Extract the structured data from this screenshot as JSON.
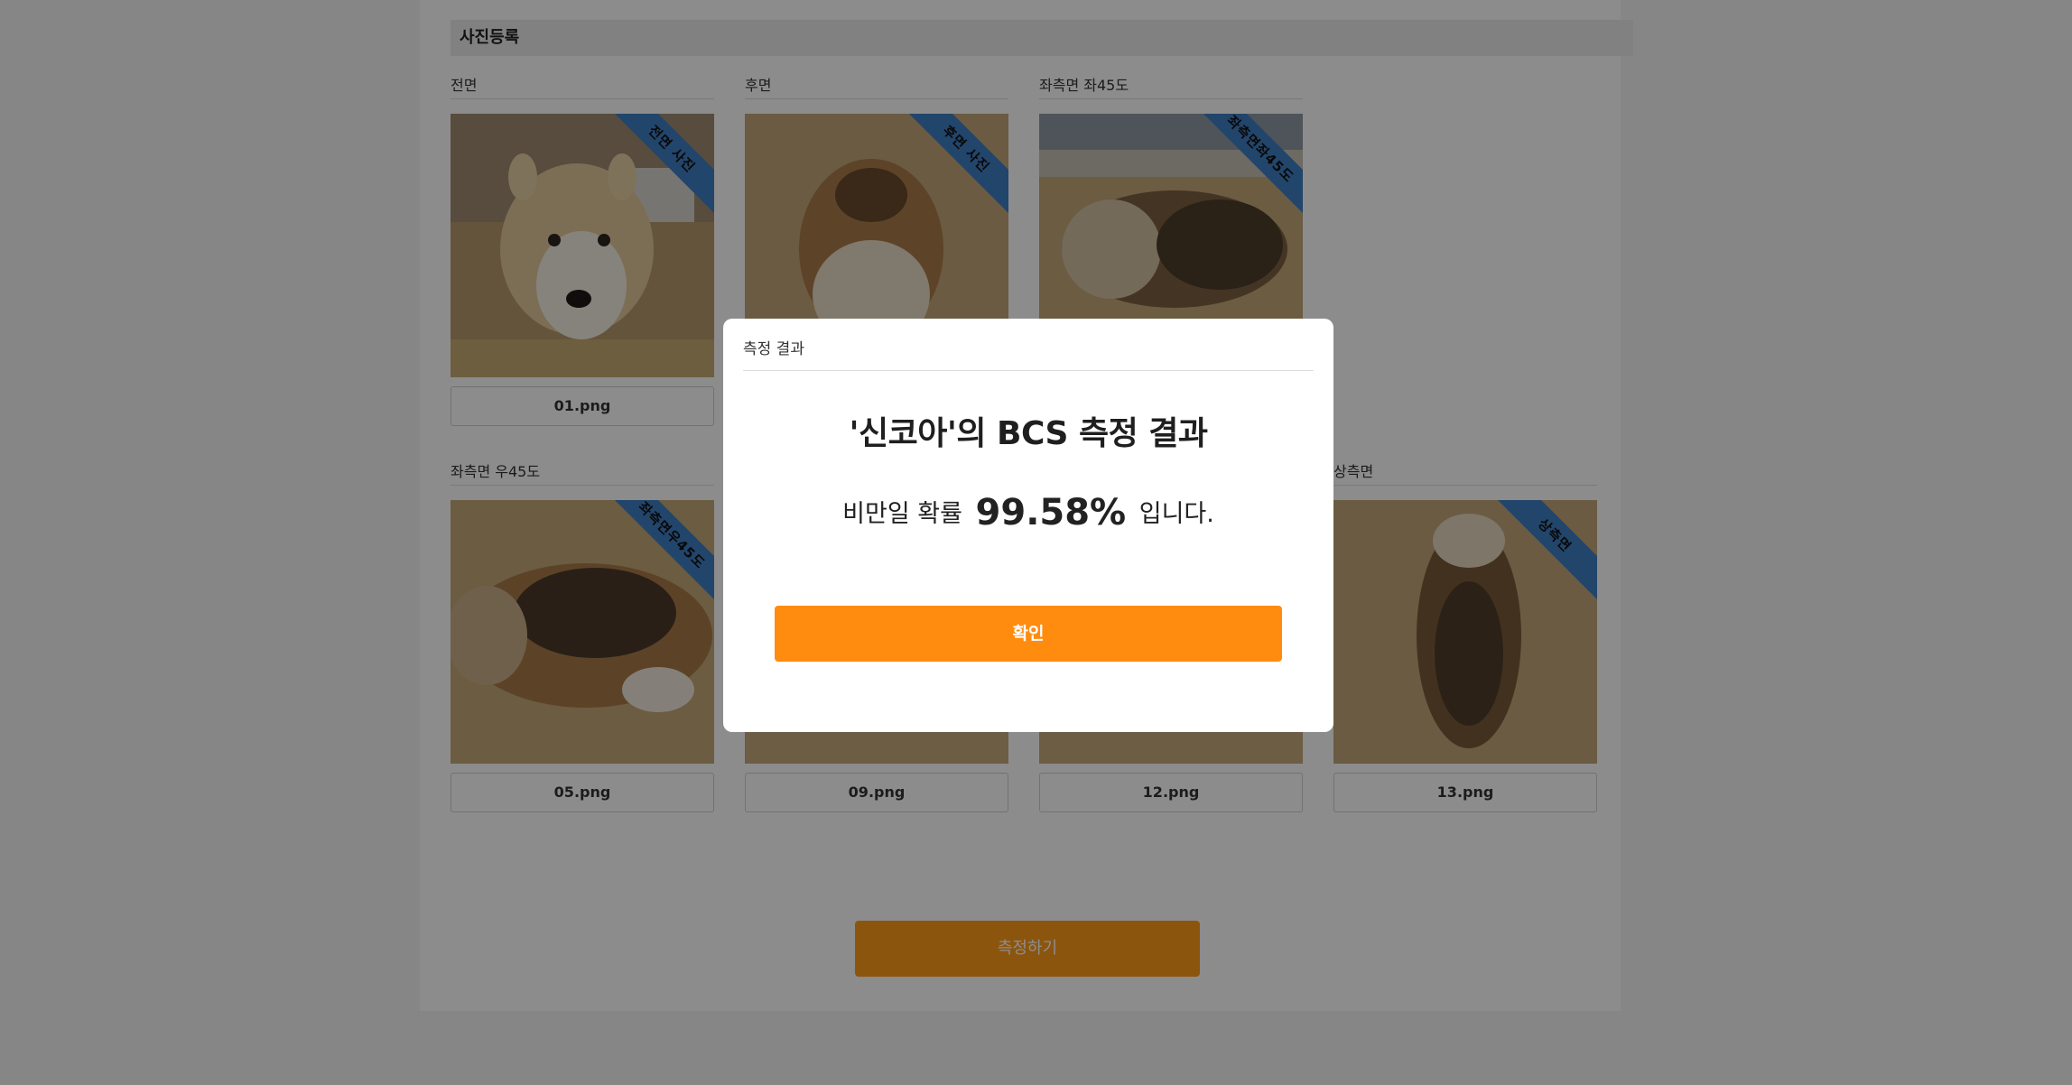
{
  "section": {
    "title": "사진등록"
  },
  "slots": [
    {
      "label": "전면",
      "ribbon": "전면 사진",
      "filename": "01.png",
      "photo": "corgi-front"
    },
    {
      "label": "후면",
      "ribbon": "후면 사진",
      "filename": "",
      "photo": "corgi-back"
    },
    {
      "label": "좌측면 좌45도",
      "ribbon": "좌측면좌45도",
      "filename": "",
      "photo": "corgi-left45"
    },
    {
      "label": "좌측면 우45도",
      "ribbon": "좌측면우45도",
      "filename": "05.png",
      "photo": "corgi-right45"
    },
    {
      "label": "",
      "ribbon": "",
      "filename": "09.png",
      "photo": "grass"
    },
    {
      "label": "",
      "ribbon": "",
      "filename": "12.png",
      "photo": "grass"
    },
    {
      "label": "상측면",
      "ribbon": "상측면",
      "filename": "13.png",
      "photo": "corgi-top"
    }
  ],
  "measure_button": {
    "label": "측정하기"
  },
  "modal": {
    "title": "측정 결과",
    "heading": "'신코아'의 BCS 측정 결과",
    "result_prefix": "비만일 확률",
    "probability": "99.58%",
    "result_suffix": "입니다.",
    "confirm_label": "확인"
  },
  "colors": {
    "accent_orange": "#ff8c0e",
    "ribbon_blue": "#3f7ec4",
    "overlay": "rgba(0,0,0,0.45)"
  }
}
